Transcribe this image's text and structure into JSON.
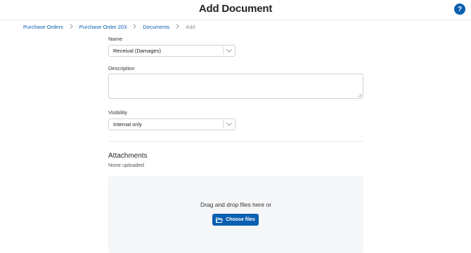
{
  "header": {
    "title": "Add Document",
    "help_label": "?"
  },
  "breadcrumb": {
    "items": [
      {
        "label": "Purchase Orders"
      },
      {
        "label": "Purchase Order 203"
      },
      {
        "label": "Documents"
      },
      {
        "label": "Add"
      }
    ]
  },
  "form": {
    "name": {
      "label": "Name",
      "value": "Receival (Damages)"
    },
    "description": {
      "label": "Description",
      "value": ""
    },
    "visibility": {
      "label": "Visibility",
      "value": "Internal only"
    }
  },
  "attachments": {
    "title": "Attachments",
    "status": "None uploaded",
    "drop_text": "Drag and drop files here or",
    "button_label": "Choose files"
  },
  "colors": {
    "accent": "#0a5fb0",
    "dropzone_bg": "#f4f6f8"
  },
  "icons": {
    "help": "help-icon",
    "chevron": "chevron-down-icon",
    "folder": "folder-open-icon"
  }
}
